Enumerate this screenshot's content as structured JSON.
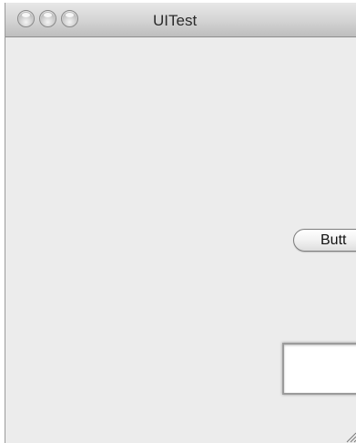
{
  "window": {
    "title": "UITest"
  },
  "content": {
    "button_label": "Butt",
    "text_box_value": ""
  },
  "icons": {
    "close": "close-icon",
    "minimize": "minimize-icon",
    "zoom": "zoom-icon",
    "resize_grip": "resize-grip-icon"
  }
}
